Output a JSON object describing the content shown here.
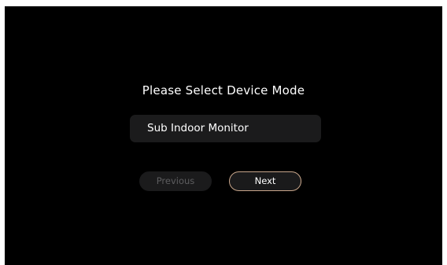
{
  "screen": {
    "title": "Please Select Device Mode",
    "mode_select": {
      "selected": "Sub Indoor Monitor"
    },
    "buttons": {
      "previous_label": "Previous",
      "next_label": "Next"
    }
  },
  "colors": {
    "background": "#000000",
    "panel": "#1b1b1c",
    "text": "#ffffff",
    "disabled_text": "#5d5d5f",
    "accent_border": "#c7a58a"
  }
}
